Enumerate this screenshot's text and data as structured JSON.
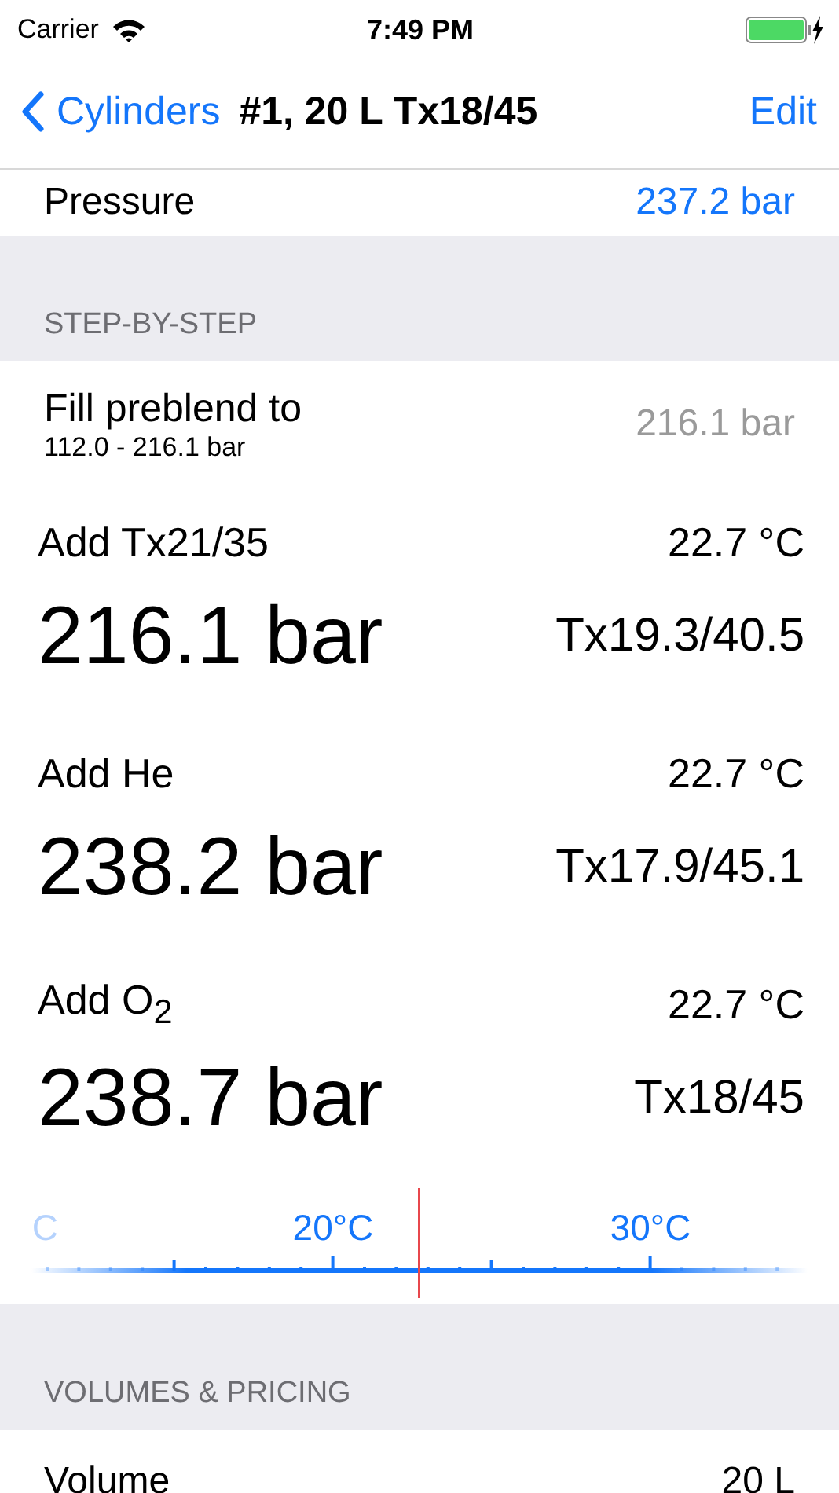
{
  "status_bar": {
    "carrier": "Carrier",
    "time": "7:49 PM"
  },
  "nav": {
    "back": "Cylinders",
    "title": "#1, 20 L Tx18/45",
    "action": "Edit"
  },
  "pressure_row": {
    "label": "Pressure",
    "value": "237.2 bar"
  },
  "step_section": {
    "header": "STEP-BY-STEP",
    "preblend": {
      "label": "Fill preblend to",
      "range": "112.0 - 216.1 bar",
      "value": "216.1 bar"
    },
    "steps": [
      {
        "label": "Add Tx21/35",
        "temperature": "22.7 °C",
        "pressure": "216.1 bar",
        "mix": "Tx19.3/40.5"
      },
      {
        "label": "Add He",
        "temperature": "22.7 °C",
        "pressure": "238.2 bar",
        "mix": "Tx17.9/45.1"
      },
      {
        "label": "Add O$_{2}$",
        "temperature": "22.7 °C",
        "pressure": "238.7 bar",
        "mix": "Tx18/45"
      }
    ]
  },
  "temperature_ruler": {
    "labels": [
      "C",
      "20°C",
      "30°C"
    ]
  },
  "volumes_section": {
    "header": "VOLUMES & PRICING",
    "rows": [
      {
        "label": "Volume",
        "value": "20 L"
      }
    ]
  }
}
